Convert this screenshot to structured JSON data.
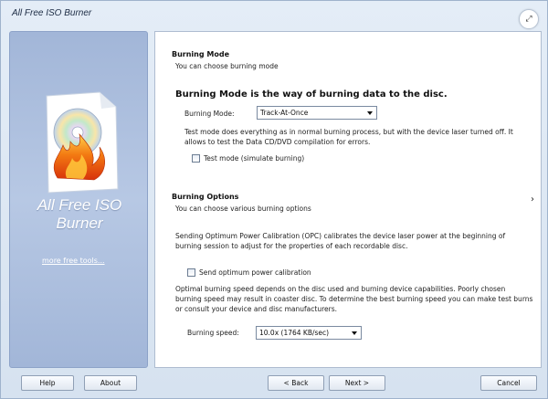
{
  "window": {
    "title": "All Free ISO Burner"
  },
  "sidebar": {
    "brand_line1": "All Free ISO",
    "brand_line2": "Burner",
    "more_link": "more free tools..."
  },
  "burning_mode": {
    "title": "Burning Mode",
    "subtitle": "You can choose burning mode",
    "headline": "Burning Mode is the way of burning data to the disc.",
    "field_label": "Burning Mode:",
    "selected_value": "Track-At-Once",
    "test_desc": "Test mode does everything as in normal burning process, but with the device laser turned off. It allows to test the Data CD/DVD compilation for errors.",
    "test_checkbox_label": "Test mode (simulate burning)",
    "test_checked": false
  },
  "burning_options": {
    "title": "Burning Options",
    "subtitle": "You can choose various burning options",
    "opc_desc": "Sending Optimum Power Calibration (OPC) calibrates the device laser power at the beginning of burning session to adjust for the properties of each recordable disc.",
    "opc_checkbox_label": "Send optimum power calibration",
    "opc_checked": false,
    "speed_desc": "Optimal burning speed depends on the disc used and burning device capabilities. Poorly chosen burning speed may result in coaster disc. To determine the best burning speed you can make test burns or consult your device and disc manufacturers.",
    "speed_label": "Burning speed:",
    "speed_value": "10.0x (1764 KB/sec)"
  },
  "buttons": {
    "help": "Help",
    "about": "About",
    "back": "< Back",
    "next": "Next >",
    "cancel": "Cancel"
  },
  "colors": {
    "sidebar": "#a9bddf",
    "window_bg": "#dbe6f2"
  },
  "icons": {
    "expand": "expand-icon",
    "right_arrow": "chevron-right-icon",
    "logo": "burning-disc-logo-icon"
  }
}
